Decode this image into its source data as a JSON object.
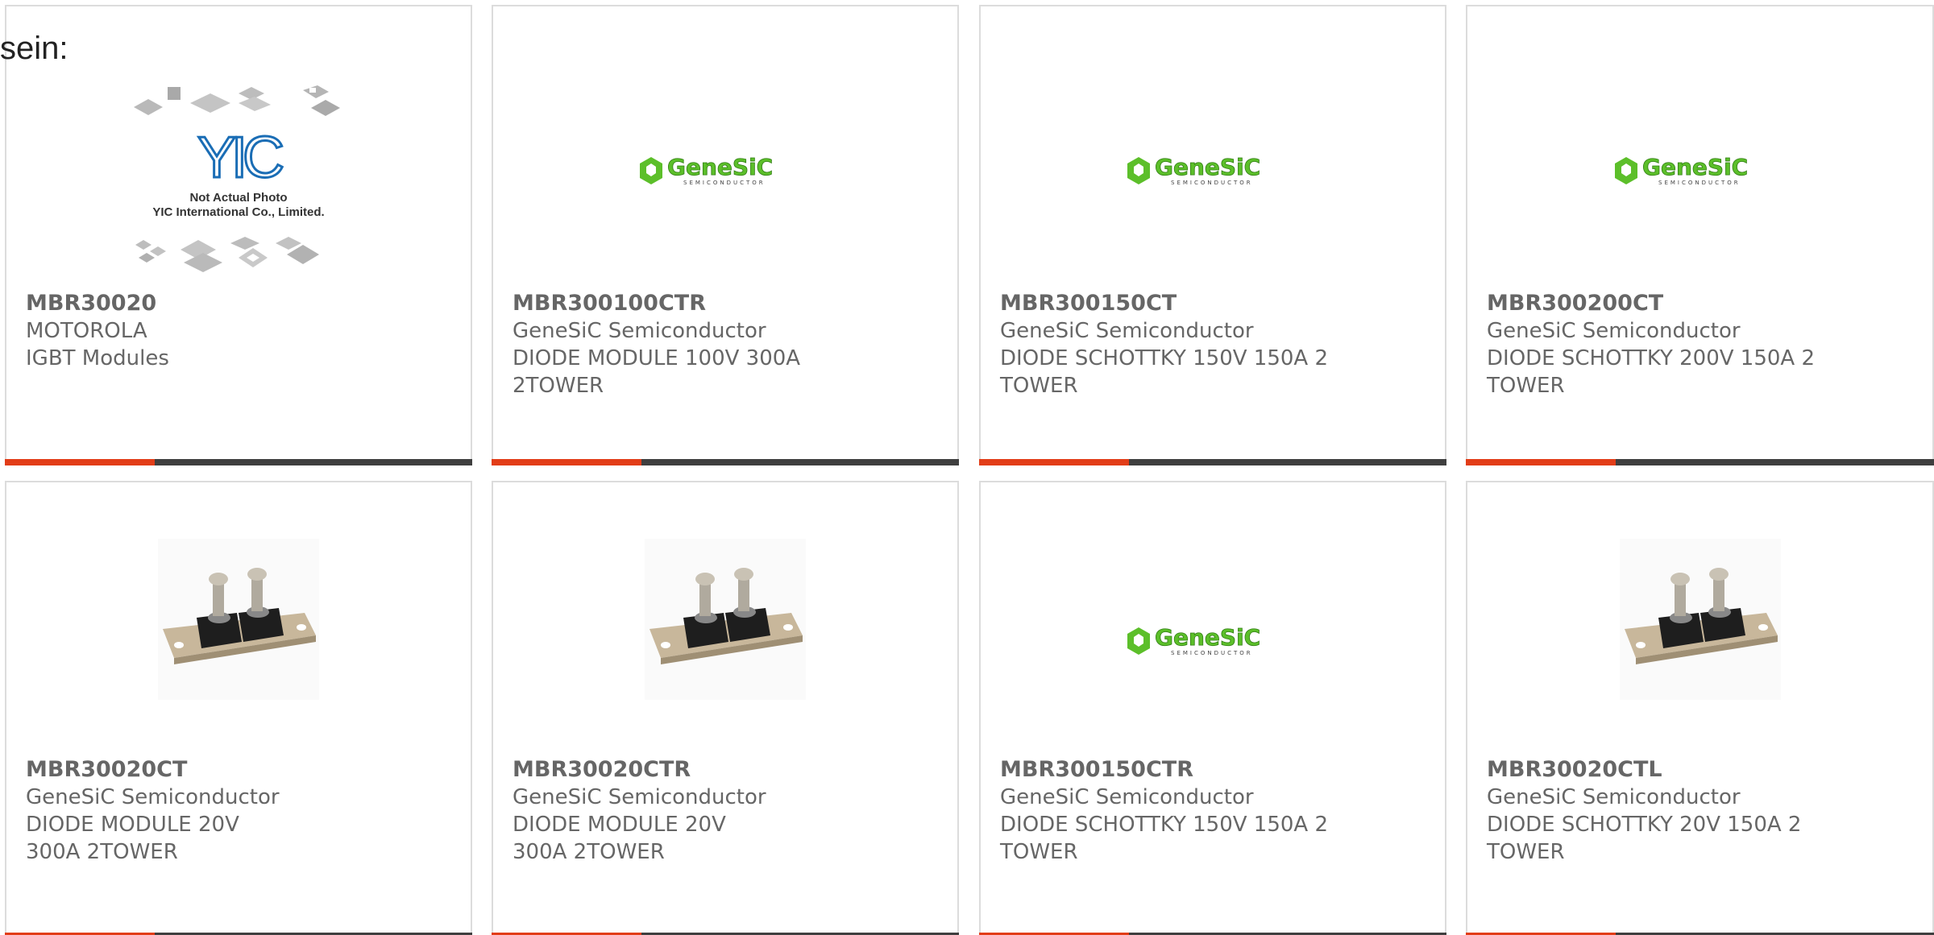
{
  "page": {
    "lead_text": "sein:"
  },
  "colors": {
    "accent": "#e23d18",
    "bar": "#3f3f3f",
    "genesic_green": "#5cbf2a",
    "yic_blue": "#1a6db5",
    "text": "#666666"
  },
  "products": [
    {
      "part_number": "MBR30020",
      "manufacturer": "MOTOROLA",
      "description": "IGBT Modules",
      "image": "yic-placeholder-icon",
      "image_caption": [
        "Not Actual Photo",
        "YIC International Co., Limited."
      ],
      "image_logo": "YIC"
    },
    {
      "part_number": "MBR300100CTR",
      "manufacturer": "GeneSiC Semiconductor",
      "description": "DIODE MODULE 100V 300A 2TOWER",
      "image": "genesic-logo-icon",
      "logo_text": "GeneSiC",
      "logo_subtext": "SEMICONDUCTOR"
    },
    {
      "part_number": "MBR300150CT",
      "manufacturer": "GeneSiC Semiconductor",
      "description": "DIODE SCHOTTKY 150V 150A 2 TOWER",
      "image": "genesic-logo-icon",
      "logo_text": "GeneSiC",
      "logo_subtext": "SEMICONDUCTOR"
    },
    {
      "part_number": "MBR300200CT",
      "manufacturer": "GeneSiC Semiconductor",
      "description": "DIODE SCHOTTKY 200V 150A 2 TOWER",
      "image": "genesic-logo-icon",
      "logo_text": "GeneSiC",
      "logo_subtext": "SEMICONDUCTOR"
    },
    {
      "part_number": "MBR30020CT",
      "manufacturer": "GeneSiC Semiconductor",
      "description": "DIODE MODULE 20V 300A 2TOWER",
      "image": "diode-module-photo"
    },
    {
      "part_number": "MBR30020CTR",
      "manufacturer": "GeneSiC Semiconductor",
      "description": "DIODE MODULE 20V 300A 2TOWER",
      "image": "diode-module-photo"
    },
    {
      "part_number": "MBR300150CTR",
      "manufacturer": "GeneSiC Semiconductor",
      "description": "DIODE SCHOTTKY 150V 150A 2 TOWER",
      "image": "genesic-logo-icon",
      "logo_text": "GeneSiC",
      "logo_subtext": "SEMICONDUCTOR"
    },
    {
      "part_number": "MBR30020CTL",
      "manufacturer": "GeneSiC Semiconductor",
      "description": "DIODE SCHOTTKY 20V 150A 2 TOWER",
      "image": "diode-module-photo"
    }
  ]
}
